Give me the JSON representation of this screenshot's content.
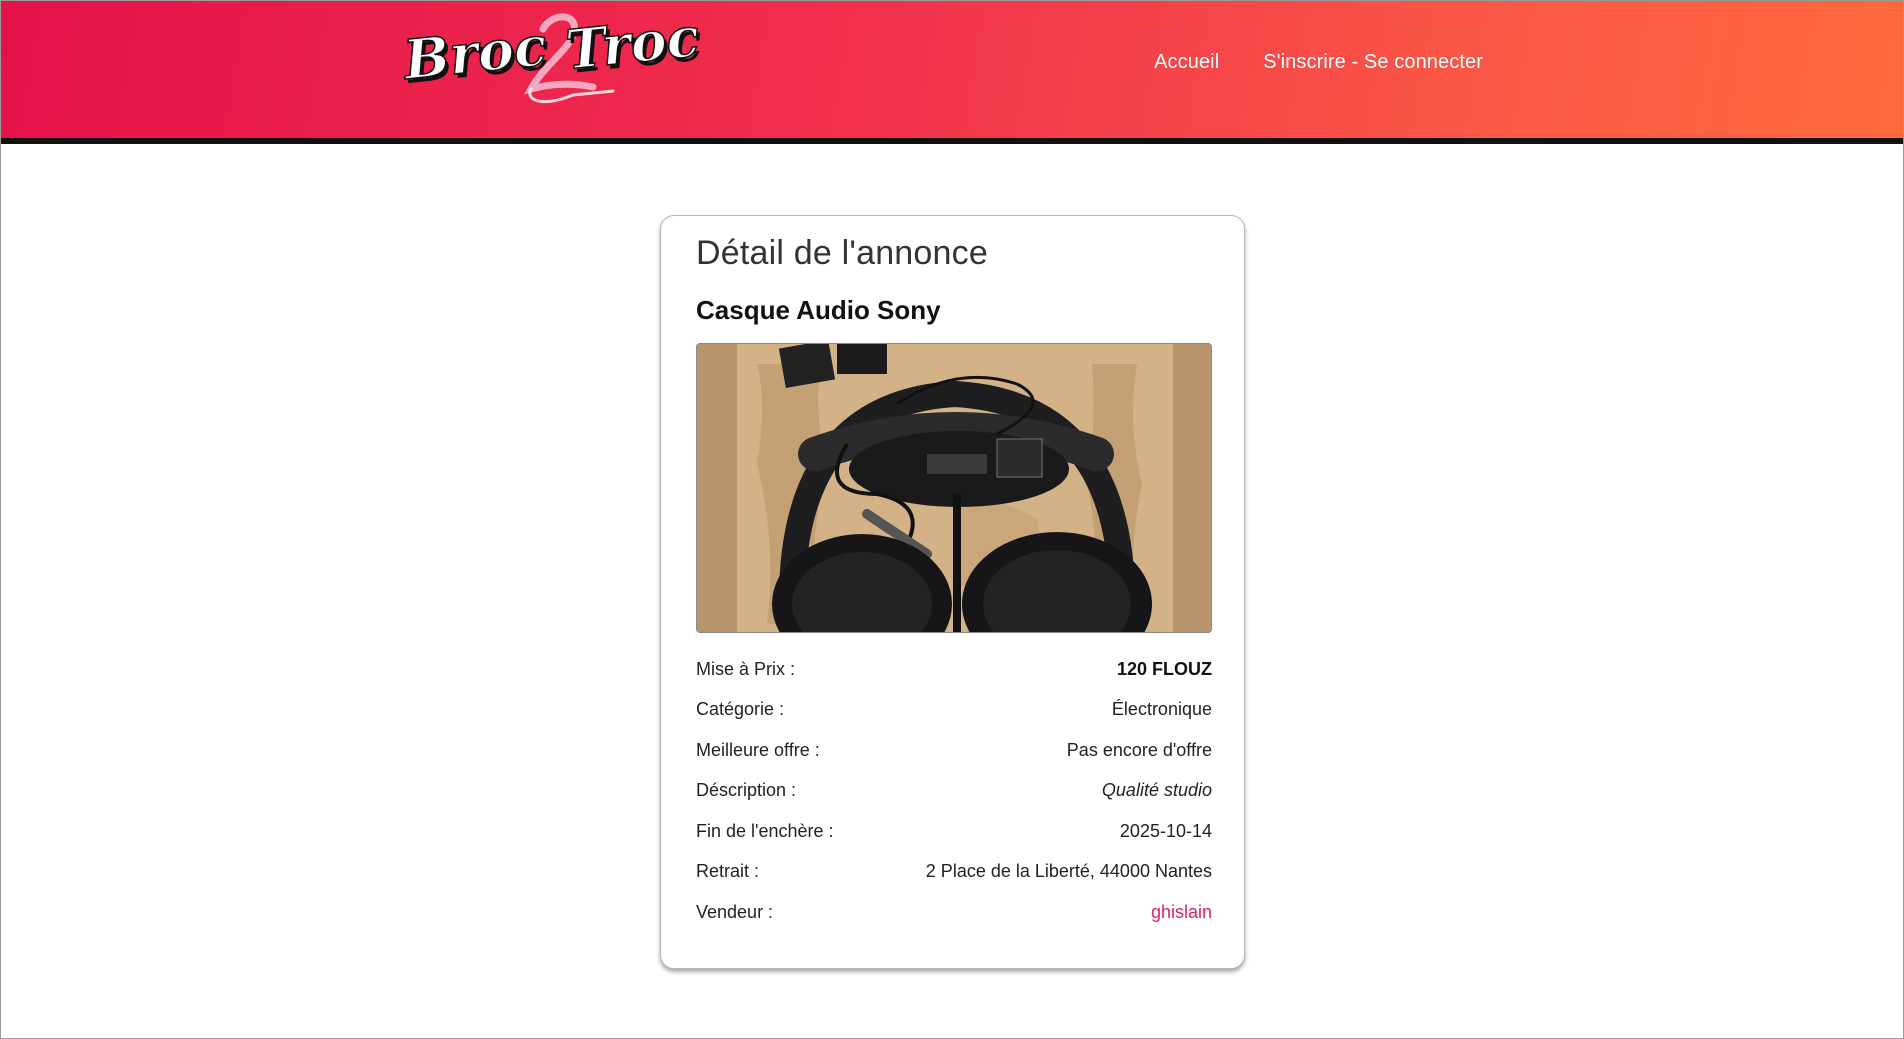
{
  "header": {
    "logo_text": "Broc2Troc",
    "nav": [
      {
        "label": "Accueil"
      },
      {
        "label": "S'inscrire - Se connecter"
      }
    ]
  },
  "listing": {
    "page_title": "Détail de l'annonce",
    "item_title": "Casque Audio Sony",
    "photo_subject": "headphones-in-box",
    "rows": [
      {
        "label": "Mise à Prix :",
        "value": "120 FLOUZ"
      },
      {
        "label": "Catégorie :",
        "value": "Électronique"
      },
      {
        "label": "Meilleure offre :",
        "value": "Pas encore d'offre"
      },
      {
        "label": "Déscription :",
        "value": "Qualité studio"
      },
      {
        "label": "Fin de l'enchère :",
        "value": "2025-10-14"
      },
      {
        "label": "Retrait :",
        "value": "2 Place de la Liberté, 44000 Nantes"
      },
      {
        "label": "Vendeur :",
        "value": "ghislain"
      }
    ]
  },
  "colors": {
    "header_start": "#e5124a",
    "header_end": "#ff6a3c",
    "seller_link": "#e0205a"
  }
}
